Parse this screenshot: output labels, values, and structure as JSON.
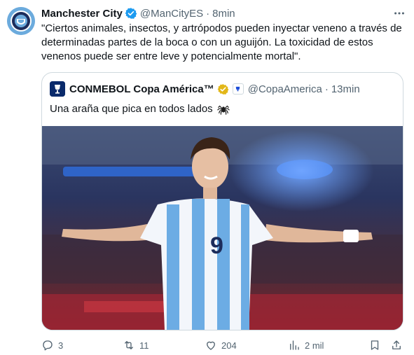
{
  "tweet": {
    "author_name": "Manchester City",
    "handle": "@ManCityES",
    "separator": "·",
    "time": "8min",
    "text": "\"Ciertos animales, insectos, y artrópodos pueden inyectar veneno a través de determinadas partes de la boca o con un aguijón. La toxicidad de estos venenos puede ser entre leve y potencialmente mortal\".",
    "verified_color": "#1d9bf0",
    "avatar_color": "#6cabdd"
  },
  "quoted": {
    "author_name": "CONMEBOL Copa América™",
    "handle": "@CopaAmerica",
    "separator": "·",
    "time": "13min",
    "text": "Una araña que pica en todos lados",
    "emoji_icon": "spider-icon",
    "verified_color": "#f4b400"
  },
  "actions": {
    "replies": "3",
    "retweets": "11",
    "likes": "204",
    "views": "2 mil"
  },
  "icons": [
    "more-icon",
    "verified-badge-icon",
    "reply-icon",
    "retweet-icon",
    "like-icon",
    "views-icon",
    "bookmark-icon",
    "share-icon"
  ]
}
